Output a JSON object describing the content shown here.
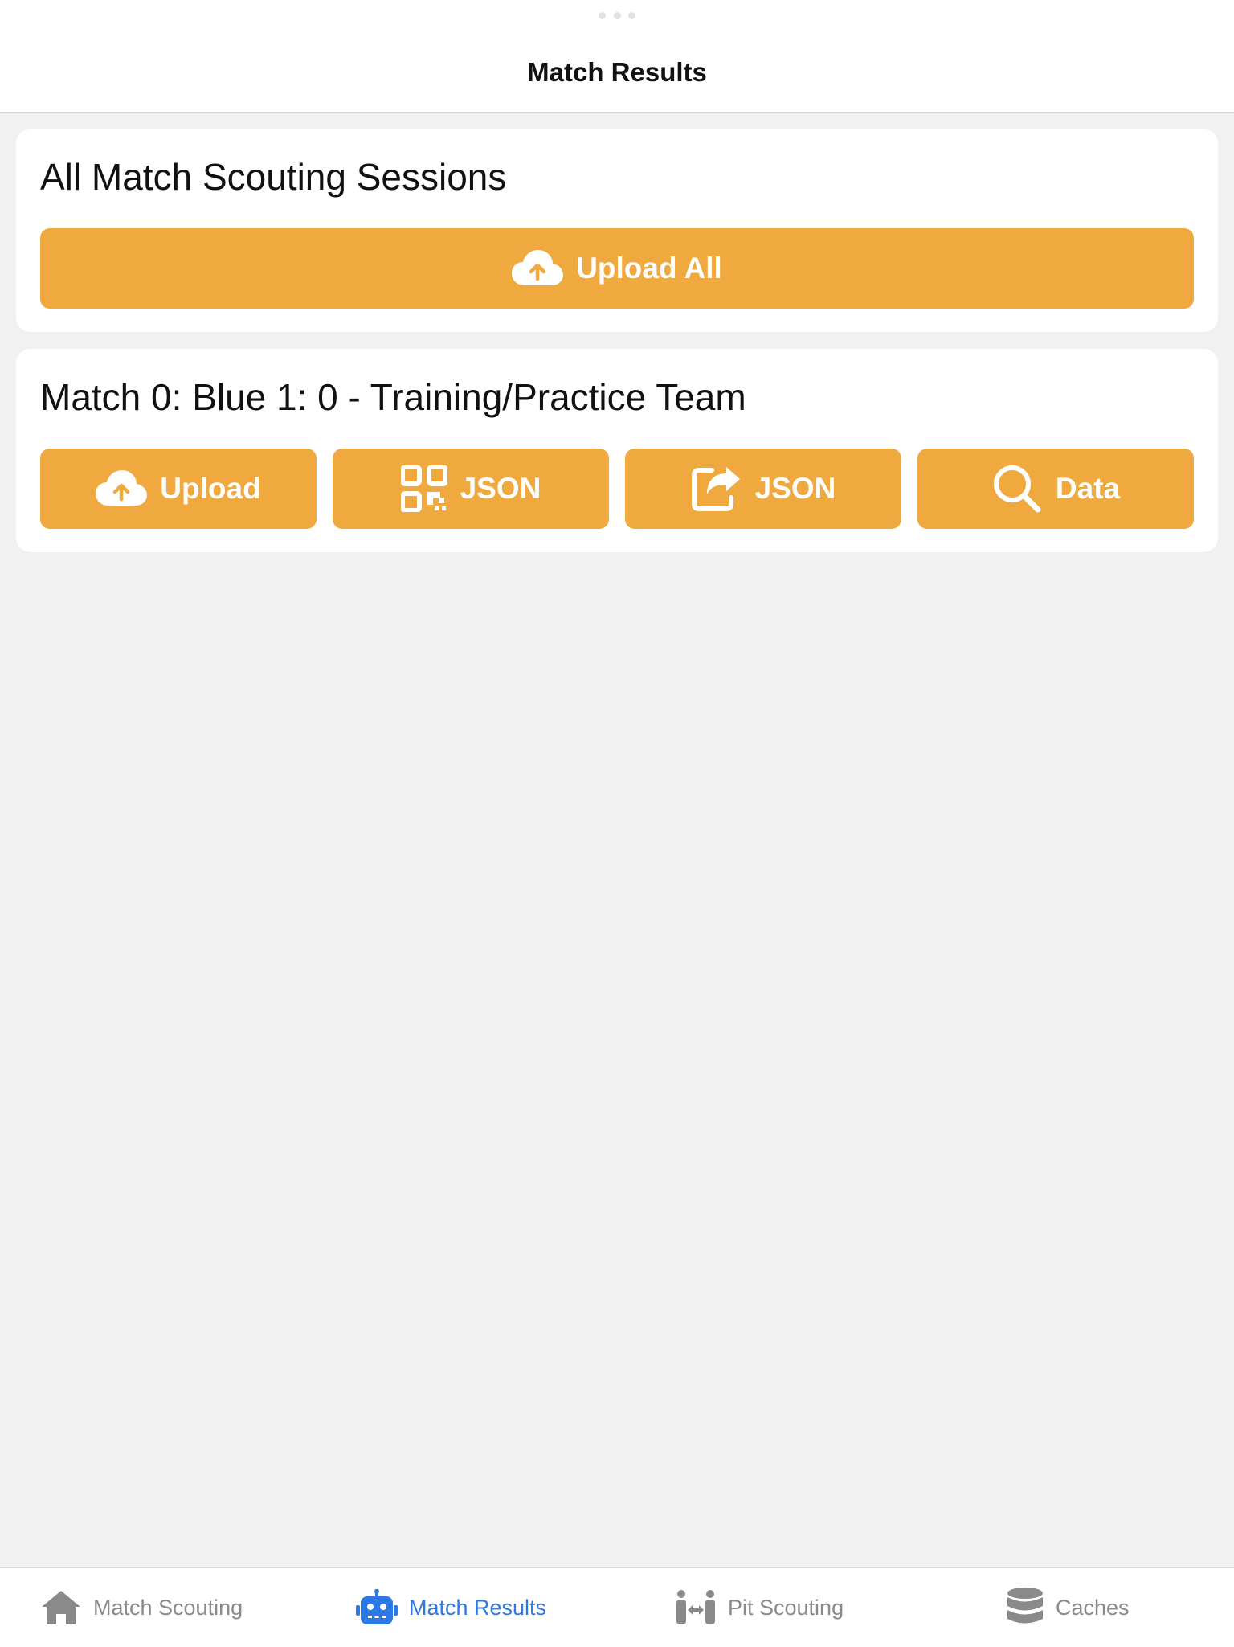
{
  "header": {
    "title": "Match Results"
  },
  "all_sessions": {
    "title": "All Match Scouting Sessions",
    "upload_all_label": "Upload All",
    "upload_all_icon": "cloud-upload-icon"
  },
  "sessions": [
    {
      "title": "Match 0: Blue 1: 0 - Training/Practice Team",
      "actions": [
        {
          "label": "Upload",
          "icon": "cloud-upload-icon"
        },
        {
          "label": "JSON",
          "icon": "qr-code-icon"
        },
        {
          "label": "JSON",
          "icon": "share-icon"
        },
        {
          "label": "Data",
          "icon": "search-icon"
        }
      ]
    }
  ],
  "tabs": [
    {
      "label": "Match Scouting",
      "icon": "home-icon",
      "active": false
    },
    {
      "label": "Match Results",
      "icon": "robot-icon",
      "active": true
    },
    {
      "label": "Pit Scouting",
      "icon": "people-arrows-icon",
      "active": false
    },
    {
      "label": "Caches",
      "icon": "database-icon",
      "active": false
    }
  ],
  "colors": {
    "accent": "#f0a93e",
    "active_tab": "#2c78e4",
    "inactive_tab": "#8a8a8a",
    "background": "#f1f1f1"
  }
}
